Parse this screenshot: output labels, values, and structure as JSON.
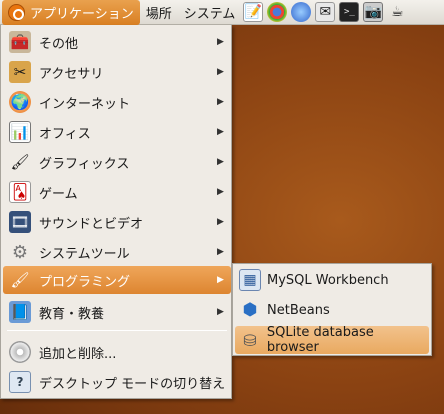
{
  "panel": {
    "menus": [
      "アプリケーション",
      "場所",
      "システム"
    ],
    "launchers": [
      {
        "icon": "text-editor-icon",
        "glyph": "📝"
      },
      {
        "icon": "chrome-icon",
        "glyph": "◉"
      },
      {
        "icon": "network-icon",
        "glyph": "🌐"
      },
      {
        "icon": "mail-icon",
        "glyph": "✉"
      },
      {
        "icon": "terminal-icon",
        "glyph": ">_"
      },
      {
        "icon": "camera-icon",
        "glyph": "📷"
      },
      {
        "icon": "java-icon",
        "glyph": "☕"
      }
    ]
  },
  "menu": {
    "items": [
      {
        "label": "その他",
        "icon": "other-icon",
        "glyph": "🧰"
      },
      {
        "label": "アクセサリ",
        "icon": "accessories-icon",
        "glyph": "✂"
      },
      {
        "label": "インターネット",
        "icon": "internet-icon",
        "glyph": "🌍"
      },
      {
        "label": "オフィス",
        "icon": "office-icon",
        "glyph": "📊"
      },
      {
        "label": "グラフィックス",
        "icon": "graphics-icon",
        "glyph": "🖌"
      },
      {
        "label": "ゲーム",
        "icon": "games-icon",
        "glyph": "🂡"
      },
      {
        "label": "サウンドとビデオ",
        "icon": "sound-video-icon",
        "glyph": "🎞"
      },
      {
        "label": "システムツール",
        "icon": "system-tools-icon",
        "glyph": "⚙"
      },
      {
        "label": "プログラミング",
        "icon": "programming-icon",
        "glyph": "🖌"
      },
      {
        "label": "教育・教養",
        "icon": "education-icon",
        "glyph": "📘"
      }
    ],
    "bottom_items": [
      {
        "label": "追加と削除...",
        "icon": "add-remove-icon",
        "glyph": "💿"
      },
      {
        "label": "デスクトップ モードの切り替え",
        "icon": "desktop-mode-icon",
        "glyph": "?"
      }
    ]
  },
  "submenu": {
    "items": [
      {
        "label": "MySQL Workbench",
        "icon": "mysql-workbench-icon",
        "glyph": "▦"
      },
      {
        "label": "NetBeans",
        "icon": "netbeans-icon",
        "glyph": "⬢"
      },
      {
        "label": "SQLite database browser",
        "icon": "database-icon",
        "glyph": "⛁"
      }
    ]
  }
}
